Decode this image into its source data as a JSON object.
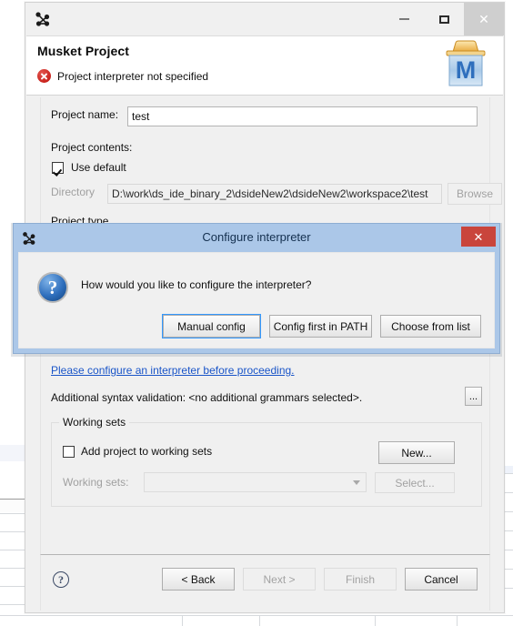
{
  "desktop": {
    "background_color": "#ffffff",
    "grid_line_color": "#d6d9dd"
  },
  "window": {
    "icon": "graph-node-icon",
    "title": "",
    "controls": {
      "minimize_label": "—",
      "maximize_label": "☐",
      "close_label": "✕"
    },
    "header": {
      "title": "Musket Project",
      "status_icon": "error-icon",
      "status_message": "Project interpreter not specified",
      "logo_icon": "musket-project-logo",
      "logo_letter": "M"
    },
    "form": {
      "project_name_label": "Project name:",
      "project_name_value": "test",
      "project_contents_label": "Project contents:",
      "use_default_label": "Use default",
      "use_default_checked": true,
      "directory_label": "Directory",
      "directory_value": "D:\\work\\ds_ide_binary_2\\dsideNew2\\dsideNew2\\workspace2\\test",
      "directory_enabled": false,
      "browse_label": "Browse",
      "browse_enabled": false,
      "project_type_label": "Project type",
      "interpreter_link": "Please configure an interpreter before proceeding.",
      "syntax_validation_text": "Additional syntax validation: <no additional grammars selected>.",
      "syntax_validation_button_label": "...",
      "working_sets_group_label": "Working sets",
      "add_to_working_sets_label": "Add project to working sets",
      "add_to_working_sets_checked": false,
      "new_button_label": "New...",
      "working_sets_label": "Working sets:",
      "working_sets_value": "",
      "working_sets_enabled": false,
      "select_button_label": "Select...",
      "link_color": "#1a55c8"
    },
    "button_bar": {
      "help_label": "?",
      "back_label": "< Back",
      "back_enabled": true,
      "next_label": "Next >",
      "next_enabled": false,
      "finish_label": "Finish",
      "finish_enabled": false,
      "cancel_label": "Cancel",
      "cancel_enabled": true
    }
  },
  "modal": {
    "icon": "graph-node-icon",
    "title": "Configure interpreter",
    "close_label": "✕",
    "close_button_color": "#c9453c",
    "titlebar_color": "#abc7e8",
    "prompt_icon": "question-icon",
    "prompt_icon_glyph": "?",
    "prompt_text": "How would you like to configure the interpreter?",
    "buttons": [
      {
        "label": "Manual config",
        "focused": true
      },
      {
        "label": "Config first in PATH",
        "focused": false
      },
      {
        "label": "Choose from list",
        "focused": false
      }
    ]
  }
}
